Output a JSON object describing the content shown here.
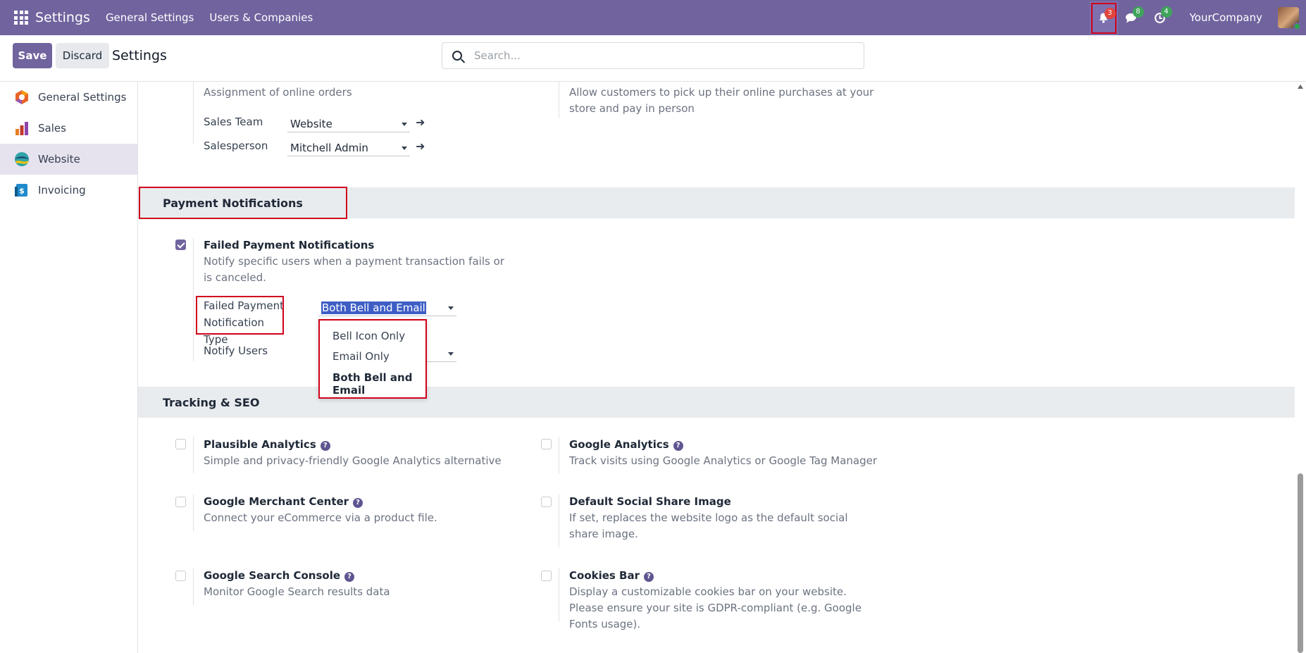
{
  "navbar": {
    "app_title": "Settings",
    "menu": [
      "General Settings",
      "Users & Companies"
    ],
    "notifications_count": "3",
    "messages_count": "8",
    "activities_count": "4",
    "company": "YourCompany"
  },
  "control_panel": {
    "save_label": "Save",
    "discard_label": "Discard",
    "title": "Settings",
    "search_placeholder": "Search..."
  },
  "sidebar": {
    "items": [
      {
        "label": "General Settings",
        "icon": "settings-app-icon",
        "color": "#e8632a"
      },
      {
        "label": "Sales",
        "icon": "sales-app-icon",
        "color": "#c0392b"
      },
      {
        "label": "Website",
        "icon": "website-app-icon",
        "color": "#2fa4a8"
      },
      {
        "label": "Invoicing",
        "icon": "invoicing-app-icon",
        "color": "#1f8acb"
      }
    ]
  },
  "orders": {
    "assignment_desc": "Assignment of online orders",
    "sales_team_label": "Sales Team",
    "sales_team_value": "Website",
    "salesperson_label": "Salesperson",
    "salesperson_value": "Mitchell Admin",
    "pickup_desc": "Allow customers to pick up their online purchases at your store and pay in person"
  },
  "payment_notifications": {
    "heading": "Payment Notifications",
    "title": "Failed Payment Notifications",
    "checked": true,
    "desc": "Notify specific users when a payment transaction fails or is canceled.",
    "type_label": "Failed Payment Notification Type",
    "type_value": "Both Bell and Email",
    "notify_users_label": "Notify Users",
    "options": [
      "Bell Icon Only",
      "Email Only",
      "Both Bell and Email"
    ]
  },
  "tracking_seo": {
    "heading": "Tracking & SEO",
    "items": [
      {
        "title": "Plausible Analytics",
        "desc": "Simple and privacy-friendly Google Analytics alternative",
        "checked": false
      },
      {
        "title": "Google Analytics",
        "desc": "Track visits using Google Analytics or Google Tag Manager",
        "checked": false
      },
      {
        "title": "Google Merchant Center",
        "desc": "Connect your eCommerce via a product file.",
        "checked": false
      },
      {
        "title": "Default Social Share Image",
        "desc": "If set, replaces the website logo as the default social share image.",
        "checked": false
      },
      {
        "title": "Google Search Console",
        "desc": "Monitor Google Search results data",
        "checked": false
      },
      {
        "title": "Cookies Bar",
        "desc": "Display a customizable cookies bar on your website. Please ensure your site is GDPR-compliant (e.g. Google Fonts usage).",
        "checked": false
      }
    ]
  },
  "colors": {
    "brand": "#71639e",
    "highlight_border": "#d0021b"
  }
}
